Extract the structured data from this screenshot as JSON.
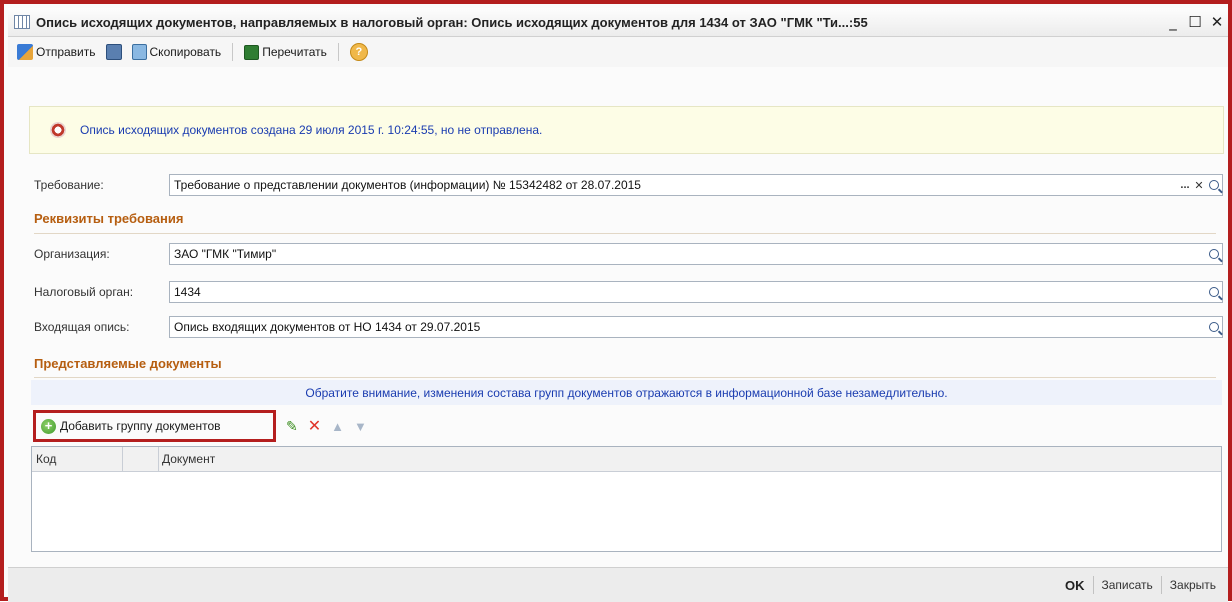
{
  "window": {
    "title": "Опись исходящих документов, направляемых в налоговый орган: Опись исходящих документов для 1434 от ЗАО \"ГМК \"Ти...:55",
    "minimize": "_",
    "maximize": "☐",
    "close": "✕"
  },
  "toolbar": {
    "send_label": "Отправить",
    "copy_label": "Скопировать",
    "reread_label": "Перечитать",
    "help_label": "?"
  },
  "banner": {
    "text": "Опись исходящих документов создана 29 июля 2015 г. 10:24:55, но не отправлена."
  },
  "requirement": {
    "label": "Требование:",
    "value": "Требование о представлении документов (информации) № 15342482 от 28.07.2015",
    "select_btn": "...",
    "clear_btn": "✕"
  },
  "requisites": {
    "title": "Реквизиты требования",
    "organization_label": "Организация:",
    "organization_value": "ЗАО \"ГМК \"Тимир\"",
    "tax_authority_label": "Налоговый орган:",
    "tax_authority_value": "1434",
    "incoming_label": "Входящая опись:",
    "incoming_value": "Опись входящих документов от НО 1434 от 29.07.2015"
  },
  "documents": {
    "title": "Представляемые документы",
    "notice": "Обратите внимание, изменения состава групп документов отражаются в информационной базе незамедлительно.",
    "add_group_label": "Добавить группу документов",
    "add_icon": "+",
    "edit_icon": "✎",
    "delete_icon": "✕",
    "up_icon": "▲",
    "down_icon": "▼",
    "columns": [
      "Код",
      "Документ"
    ],
    "rows": []
  },
  "footer": {
    "ok_label": "OK",
    "save_label": "Записать",
    "close_label": "Закрыть"
  },
  "colors": {
    "highlight_border": "#b41e1e",
    "section_title": "#b65e10",
    "link_text": "#1a3cb0"
  }
}
